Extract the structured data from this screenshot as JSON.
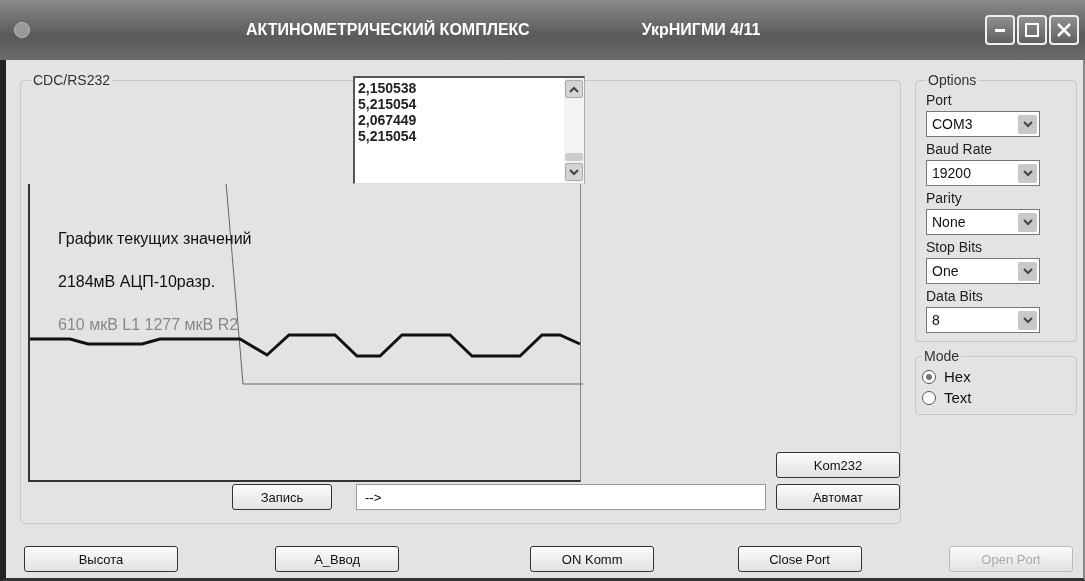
{
  "window": {
    "title": "АКТИНОМЕТРИЧЕСКИЙ КОМПЛЕКС",
    "subtitle": "УкрНИГМИ 4/11"
  },
  "connection": {
    "legend": "CDC/RS232",
    "readings": [
      "2,150538",
      "5,215054",
      "2,067449",
      "5,215054"
    ],
    "graph": {
      "title": "График текущих значений",
      "scale": "2184мВ  АЦП-10разр.",
      "channels": "610 мкВ L1  1277  мкВ R2"
    },
    "kom_button": "Kom232",
    "record_button": "Запись",
    "command_field": {
      "value": "-->"
    },
    "auto_button": "Автомат"
  },
  "options": {
    "legend": "Options",
    "fields": [
      {
        "label": "Port",
        "value": "COM3"
      },
      {
        "label": "Baud Rate",
        "value": "19200"
      },
      {
        "label": "Parity",
        "value": "None"
      },
      {
        "label": "Stop Bits",
        "value": "One"
      },
      {
        "label": "Data Bits",
        "value": "8"
      }
    ]
  },
  "mode": {
    "legend": "Mode",
    "options": [
      {
        "label": "Hex",
        "selected": true
      },
      {
        "label": "Text",
        "selected": false
      }
    ]
  },
  "buttons": [
    {
      "label": "Высота",
      "disabled": false
    },
    {
      "label": "А_Ввод",
      "disabled": false
    },
    {
      "label": "ON Komm",
      "disabled": false
    },
    {
      "label": "Close Port",
      "disabled": false
    },
    {
      "label": "Open Port",
      "disabled": true
    }
  ]
}
